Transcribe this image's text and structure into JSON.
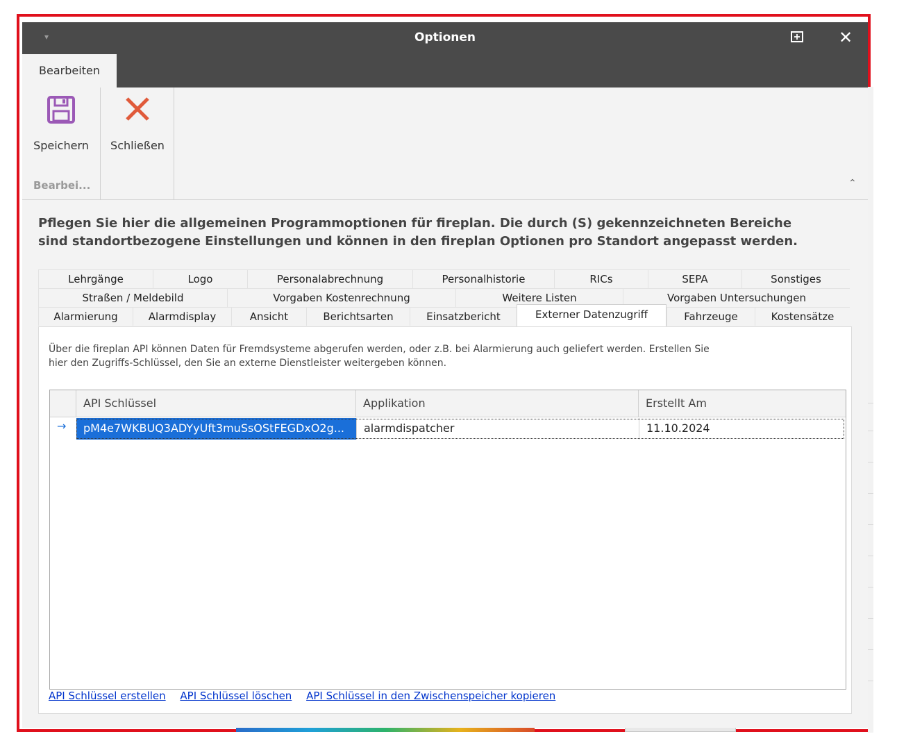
{
  "window": {
    "title": "Optionen"
  },
  "ribbon": {
    "tab": "Bearbeiten",
    "save_label": "Speichern",
    "close_label": "Schließen",
    "group_label": "Bearbei..."
  },
  "description": "Pflegen Sie hier die allgemeinen Programmoptionen für fireplan. Die durch (S) gekennzeichneten Bereiche sind standortbezogene Einstellungen und können in den fireplan Optionen pro Standort angepasst werden.",
  "tabs": {
    "row1": [
      "Lehrgänge",
      "Logo",
      "Personalabrechnung",
      "Personalhistorie",
      "RICs",
      "SEPA",
      "Sonstiges"
    ],
    "row2": [
      "Straßen / Meldebild",
      "Vorgaben Kostenrechnung",
      "Weitere Listen",
      "Vorgaben Untersuchungen"
    ],
    "row3": [
      "Alarmierung",
      "Alarmdisplay",
      "Ansicht",
      "Berichtsarten",
      "Einsatzbericht",
      "Externer Datenzugriff",
      "Fahrzeuge",
      "Kostensätze"
    ],
    "active": "Externer Datenzugriff"
  },
  "panel": {
    "info_line1": "Über die fireplan API können Daten für Fremdsysteme abgerufen werden, oder z.B. bei Alarmierung auch geliefert werden. Erstellen Sie",
    "info_line2": "hier den Zugriffs-Schlüssel, den Sie an externe Dienstleister weitergeben können.",
    "grid": {
      "columns": [
        "API Schlüssel",
        "Applikation",
        "Erstellt Am"
      ],
      "rows": [
        {
          "key": "pM4e7WKBUQ3ADYyUft3muSsOStFEGDxO2g...",
          "app": "alarmdispatcher",
          "date": "11.10.2024"
        }
      ]
    },
    "links": {
      "create": "API Schlüssel erstellen",
      "delete": "API Schlüssel löschen",
      "copy": "API Schlüssel in den Zwischenspeicher kopieren"
    }
  },
  "colors": {
    "accent": "#1a6fd9",
    "frame": "#e0101c",
    "titlebar": "#4a4a4a",
    "save_icon": "#9b59b6",
    "close_icon": "#e05a3a"
  },
  "icons": {
    "save": "floppy-disk-icon",
    "close": "close-x-icon"
  }
}
